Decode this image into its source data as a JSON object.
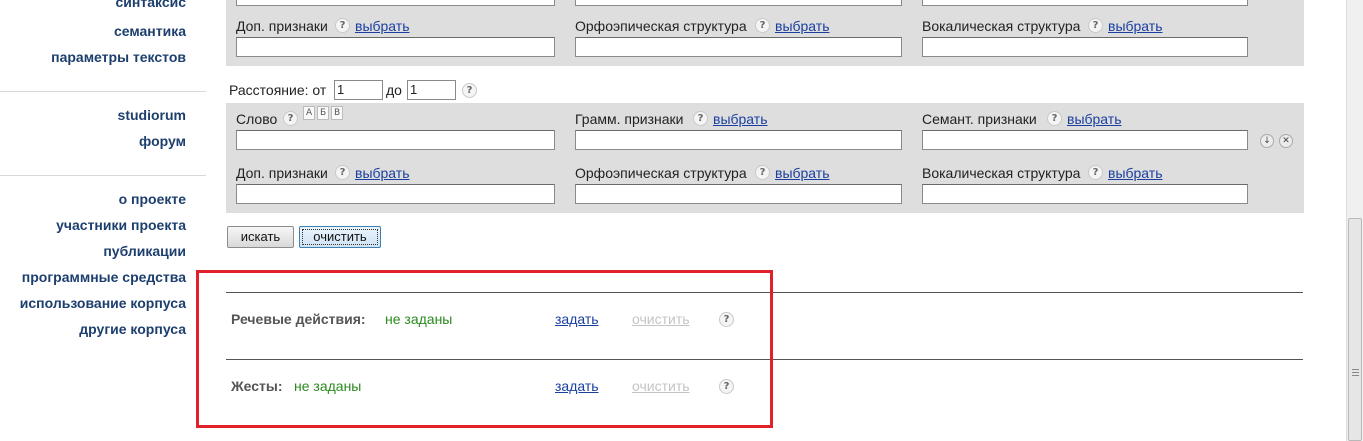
{
  "sidebar": {
    "top_links": [
      "синтаксис",
      "семантика",
      "параметры текстов"
    ],
    "forum_links": [
      "studiorum",
      "форум"
    ],
    "about_links": [
      "о проекте",
      "участники проекта",
      "публикации",
      "программные средства",
      "использование корпуса",
      "другие корпуса"
    ]
  },
  "word_block": {
    "word_label": "Слово",
    "gram_label": "Грамм. признаки",
    "sem_label": "Семант. признаки",
    "add_label": "Доп. признаки",
    "orth_label": "Орфоэпическая структура",
    "vocal_label": "Вокалическая структура",
    "choose_link": "выбрать",
    "help": "?",
    "kb_keys": [
      "А",
      "Б",
      "В"
    ]
  },
  "distance": {
    "label": "Расстояние: от",
    "from_value": "1",
    "to_label": "до",
    "to_value": "1"
  },
  "buttons": {
    "search": "искать",
    "clear": "очистить"
  },
  "speech_acts": {
    "title": "Речевые действия:",
    "value": "не заданы",
    "set_link": "задать",
    "clear_link": "очистить"
  },
  "gestures": {
    "title": "Жесты:",
    "value": "не заданы",
    "set_link": "задать",
    "clear_link": "очистить"
  },
  "colors": {
    "highlight_box": "#e0202a",
    "link": "#1a3fa0",
    "value_green": "#2a8a1e",
    "panel_gray": "#dedede"
  }
}
